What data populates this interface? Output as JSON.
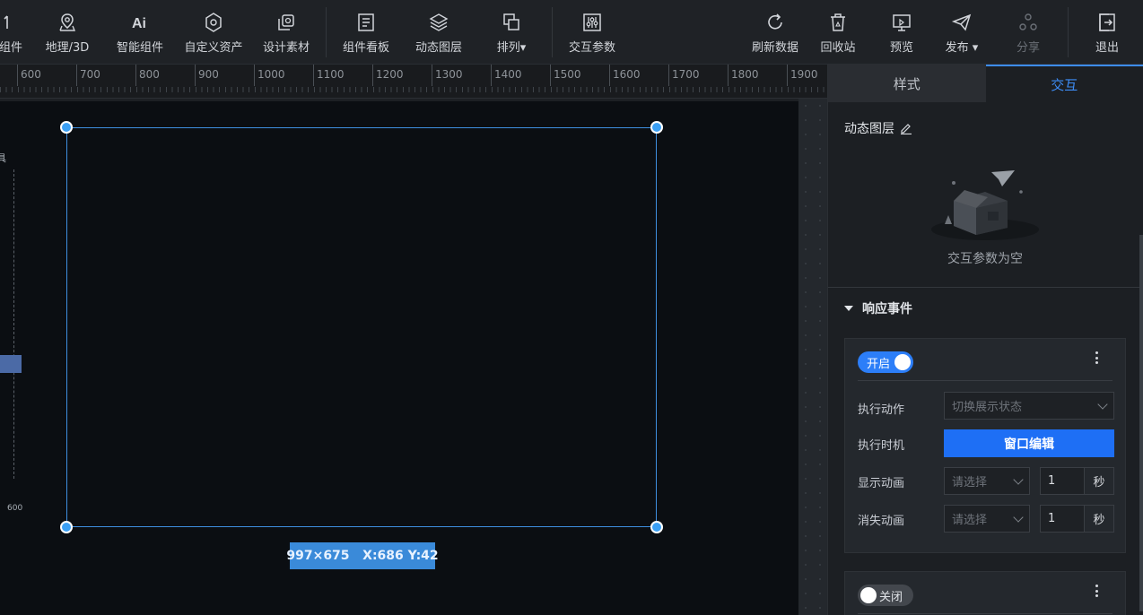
{
  "toolbar": {
    "items": [
      {
        "label": "组件",
        "icon": "component-icon"
      },
      {
        "label": "地理/3D",
        "icon": "map-pin-icon"
      },
      {
        "label": "智能组件",
        "icon": "ai-icon"
      },
      {
        "label": "自定义资产",
        "icon": "hexagon-icon"
      },
      {
        "label": "设计素材",
        "icon": "material-icon"
      },
      {
        "label": "组件看板",
        "icon": "board-icon"
      },
      {
        "label": "动态图层",
        "icon": "layers-icon"
      },
      {
        "label": "排列▾",
        "icon": "arrange-icon"
      },
      {
        "label": "交互参数",
        "icon": "sliders-icon"
      },
      {
        "label": "刷新数据",
        "icon": "refresh-icon"
      },
      {
        "label": "回收站",
        "icon": "trash-icon"
      },
      {
        "label": "预览",
        "icon": "monitor-icon"
      },
      {
        "label": "发布 ▾",
        "icon": "send-icon"
      },
      {
        "label": "分享",
        "icon": "share-icon"
      },
      {
        "label": "退出",
        "icon": "exit-icon"
      }
    ],
    "ai_glyph": "Ai"
  },
  "ruler": {
    "ticks": [
      "600",
      "700",
      "800",
      "900",
      "1000",
      "1100",
      "1200",
      "1300",
      "1400",
      "1500",
      "1600",
      "1700",
      "1800",
      "1900"
    ]
  },
  "canvas": {
    "vertical_label": "600",
    "edge_char": "具",
    "selection_info": "997×675   X:686 Y:42",
    "selection_color": "#3e8fe0",
    "handle_color": "#3ba0f5"
  },
  "panel": {
    "tabs": [
      {
        "label": "样式",
        "active": false
      },
      {
        "label": "交互",
        "active": true
      }
    ],
    "layer_title": "动态图层",
    "empty_text": "交互参数为空",
    "response_events_title": "响应事件",
    "card1": {
      "toggle_label": "开启",
      "toggle_on": true,
      "exec_action_label": "执行动作",
      "exec_action_placeholder": "切换展示状态",
      "exec_timing_label": "执行时机",
      "window_edit_button": "窗口编辑",
      "show_anim_label": "显示动画",
      "show_anim_placeholder": "请选择",
      "show_anim_value": "1",
      "show_anim_unit": "秒",
      "hide_anim_label": "消失动画",
      "hide_anim_placeholder": "请选择",
      "hide_anim_value": "1",
      "hide_anim_unit": "秒"
    },
    "card2": {
      "toggle_label": "关闭",
      "toggle_on": false
    },
    "accent_color": "#3d8cf5",
    "button_color": "#1e6ff5"
  }
}
